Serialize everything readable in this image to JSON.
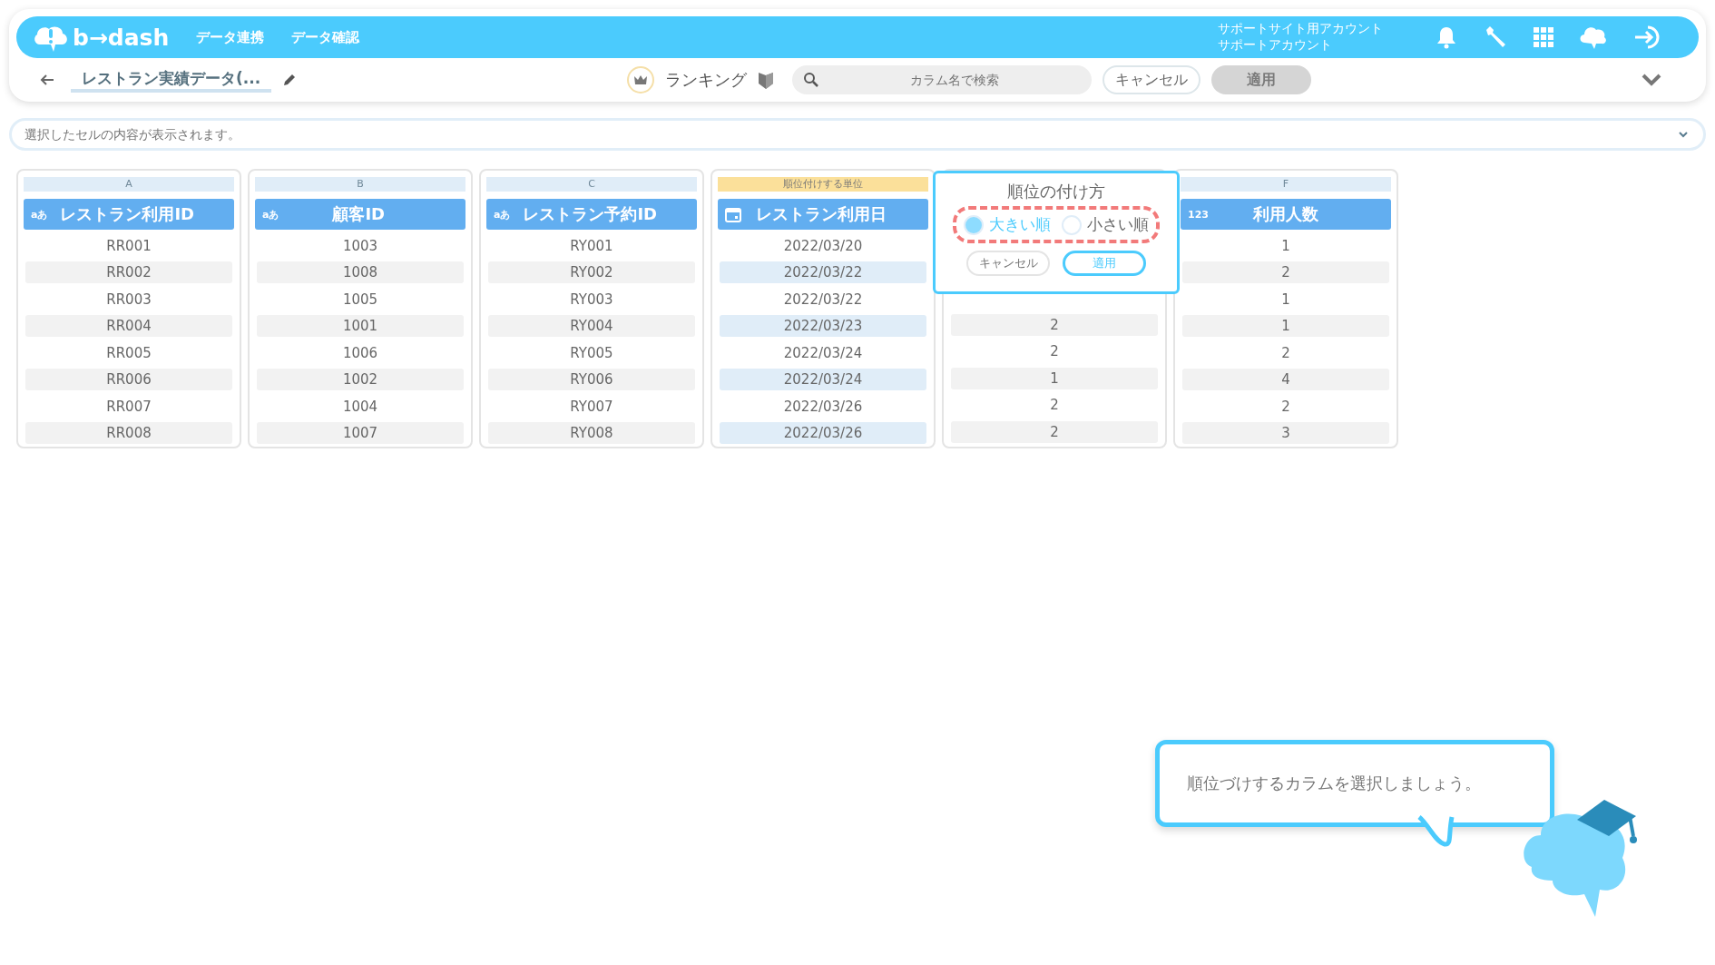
{
  "header": {
    "logo": "b→dash",
    "nav": [
      {
        "label": "データ連携"
      },
      {
        "label": "データ確認"
      }
    ],
    "account": [
      "サポートサイト用アカウント",
      "サポートアカウント"
    ]
  },
  "toolbar": {
    "title": "レストラン実績データ(...",
    "mode": "ランキング",
    "search": {
      "placeholder": "カラム名で検索"
    },
    "cancel": "キャンセル",
    "apply": {
      "label": "適用",
      "disabled": true
    }
  },
  "cell_bar": {
    "placeholder": "選択したセルの内容が表示されます。"
  },
  "columns": [
    {
      "letter": "A",
      "kind": "text",
      "type_label": "aあ",
      "name": "レストラン利用ID",
      "selected": false,
      "values": [
        "RR001",
        "RR002",
        "RR003",
        "RR004",
        "RR005",
        "RR006",
        "RR007",
        "RR008"
      ]
    },
    {
      "letter": "B",
      "kind": "text",
      "type_label": "aあ",
      "name": "顧客ID",
      "selected": false,
      "values": [
        "1003",
        "1008",
        "1005",
        "1001",
        "1006",
        "1002",
        "1004",
        "1007"
      ]
    },
    {
      "letter": "C",
      "kind": "text",
      "type_label": "aあ",
      "name": "レストラン予約ID",
      "selected": false,
      "values": [
        "RY001",
        "RY002",
        "RY003",
        "RY004",
        "RY005",
        "RY006",
        "RY007",
        "RY008"
      ]
    },
    {
      "letter": "順位付けする単位",
      "kind": "date",
      "name": "レストラン利用日",
      "selected": true,
      "values": [
        "2022/03/20",
        "2022/03/22",
        "2022/03/22",
        "2022/03/23",
        "2022/03/24",
        "2022/03/24",
        "2022/03/26",
        "2022/03/26"
      ]
    },
    {
      "kind": "popup",
      "values": [
        "2",
        "2",
        "1",
        "2",
        "2"
      ]
    },
    {
      "letter": "F",
      "kind": "number",
      "type_label": "123",
      "name": "利用人数",
      "selected": false,
      "values": [
        "1",
        "2",
        "1",
        "1",
        "2",
        "4",
        "2",
        "3"
      ]
    }
  ],
  "popup": {
    "title": "順位の付け方",
    "options": [
      {
        "label": "大きい順",
        "selected": true
      },
      {
        "label": "小さい順",
        "selected": false
      }
    ],
    "cancel": "キャンセル",
    "apply": "適用"
  },
  "tip": {
    "text": "順位づけするカラムを選択しましょう。"
  }
}
